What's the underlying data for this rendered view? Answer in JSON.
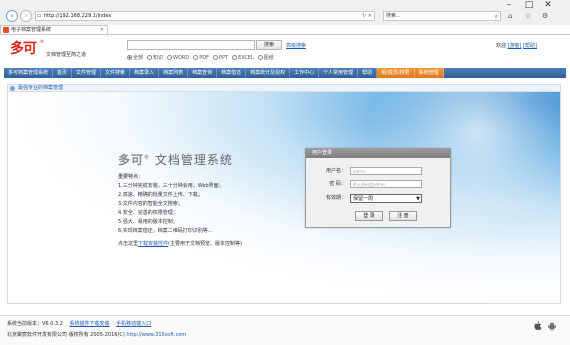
{
  "browser": {
    "url": "http://192.168.229.1/index",
    "search_placeholder": "搜索...",
    "tab_title": "电子档案管理系统"
  },
  "header": {
    "logo_text": "多可",
    "logo_reg": "®",
    "logo_subtitle": "文档管理至简之道",
    "search_button": "搜索",
    "advanced_search": "高级搜索",
    "filters": [
      "全部",
      "知识",
      "WORD",
      "PDF",
      "PPT",
      "EXCEL",
      "图纸"
    ],
    "welcome_prefix": "欢迎",
    "guest": "[游客]",
    "help": "[帮助]"
  },
  "nav": {
    "items": [
      "多可档案管理系统",
      "首页",
      "文件管理",
      "文件搜索",
      "档案录入",
      "档案列表",
      "档案查询",
      "档案借还",
      "档案统计及授权",
      "工作中心",
      "个人常用管理",
      "帮助"
    ],
    "orange_items": [
      "组/成员/权限",
      "系统管理"
    ]
  },
  "content": {
    "breadcrumb": "最强专业的档案管理",
    "product_brand": "多可",
    "product_reg": "®",
    "product_name": "文档管理系统",
    "features_title": "重要特点：",
    "features": [
      "1.三分钟完成安装，三十分钟会用，Web界面；",
      "2.高速、精确的批量文件上传、下载；",
      "3.文件内容的智能全文搜索；",
      "4.安全、完善的权限管理；",
      "5.强大、易用的版本控制；",
      "6.实现档案借还，档案二维码打印识别等..."
    ],
    "install_prefix": "点击这里",
    "install_link": "下载安装控件",
    "install_suffix": "(主要用于文档预览、版本控制等)"
  },
  "login": {
    "header": "用户登录",
    "username_label": "用户名：",
    "username_placeholder": "admin",
    "password_label": "密 码：",
    "password_placeholder": "默认密码是admin",
    "validity_label": "有效期：",
    "validity_value": "保留一周",
    "login_button": "登 录",
    "register_button": "注 册"
  },
  "footer": {
    "version_label": "系统当前版本：V6.0.3.2",
    "link_plugin": "系统插件下载安装",
    "link_mobile": "手机移动端入口",
    "copyright_prefix": "北京聚宸软件开发有限公司 版权所有 2005-2016(C) ",
    "copyright_link": "http://www.315soft.com"
  }
}
